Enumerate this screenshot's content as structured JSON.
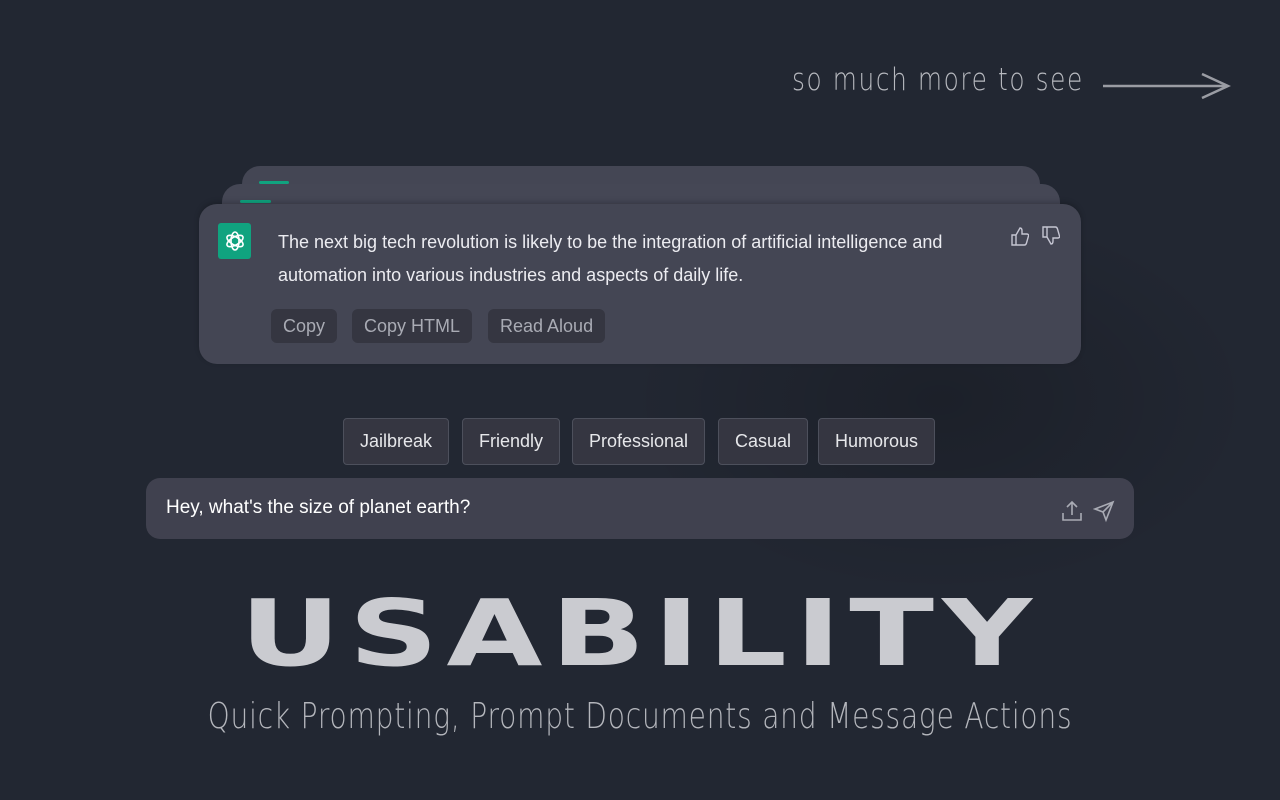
{
  "banner": {
    "more_text": "so much more to see",
    "arrow_icon": "arrow-right-icon"
  },
  "message": {
    "text": "The next big tech revolution is likely to be the integration of artificial intelligence and automation into various industries and aspects of daily life.",
    "actions": [
      "Copy",
      "Copy HTML",
      "Read Aloud"
    ],
    "accent": "#10a37f"
  },
  "tones": [
    "Jailbreak",
    "Friendly",
    "Professional",
    "Casual",
    "Humorous"
  ],
  "prompt": {
    "value": "Hey, what's the size of planet earth?"
  },
  "headline": "USABILITY",
  "subheadline": "Quick Prompting, Prompt Documents and Message Actions"
}
